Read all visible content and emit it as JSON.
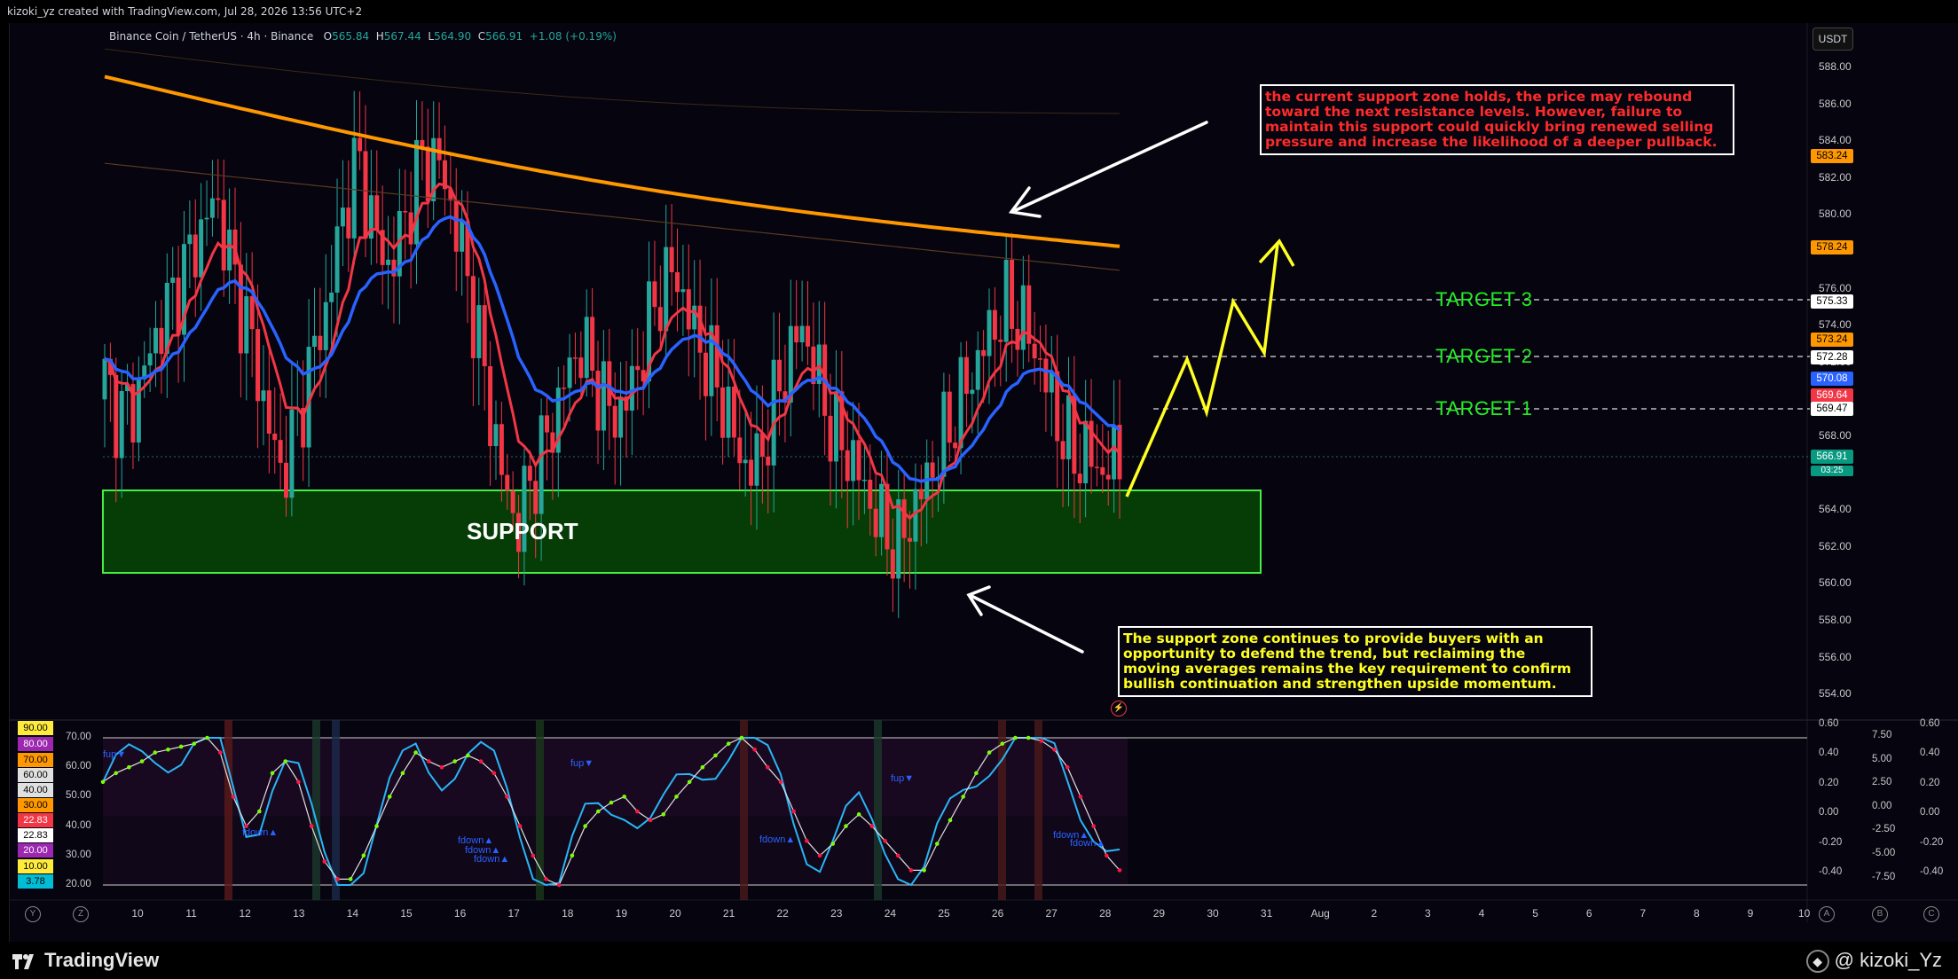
{
  "topbar": {
    "text": "kizoki_yz created with TradingView.com, Jul 28, 2026 13:56 UTC+2"
  },
  "header": {
    "symbol": "Binance Coin / TetherUS · 4h · Binance",
    "o_label": "O",
    "o": "565.84",
    "h_label": "H",
    "h": "567.44",
    "l_label": "L",
    "l": "564.90",
    "c_label": "C",
    "c": "566.91",
    "change": "+1.08 (+0.19%)"
  },
  "currency_button": "USDT",
  "notes": {
    "top": "the current support zone holds, the price may rebound toward the next resistance levels. However, failure to maintain this support could quickly bring renewed selling pressure and increase the likelihood of a deeper pullback.",
    "bottom": "The support zone continues to provide buyers with an opportunity to defend the trend, but reclaiming the moving averages remains the key requirement to confirm bullish continuation and strengthen upside momentum."
  },
  "targets": {
    "t1": "TARGET 1",
    "t2": "TARGET 2",
    "t3": "TARGET 3"
  },
  "support_label": "SUPPORT",
  "price_axis": [
    "588.00",
    "586.00",
    "584.00",
    "582.00",
    "580.00",
    "578.00",
    "576.00",
    "574.00",
    "572.00",
    "570.00",
    "568.00",
    "566.00",
    "564.00",
    "562.00",
    "560.00",
    "558.00",
    "556.00",
    "554.00"
  ],
  "price_tags": [
    {
      "value": "583.24",
      "bg": "#ff9800",
      "fg": "#000000"
    },
    {
      "value": "578.24",
      "bg": "#ff9800",
      "fg": "#000000"
    },
    {
      "value": "575.33",
      "bg": "#ffffff",
      "fg": "#000000"
    },
    {
      "value": "573.24",
      "bg": "#ff9800",
      "fg": "#000000"
    },
    {
      "value": "572.28",
      "bg": "#ffffff",
      "fg": "#000000"
    },
    {
      "value": "570.08",
      "bg": "#2962ff",
      "fg": "#ffffff"
    },
    {
      "value": "569.64",
      "bg": "#f23645",
      "fg": "#ffffff"
    },
    {
      "value": "569.47",
      "bg": "#ffffff",
      "fg": "#000000"
    },
    {
      "value": "566.91",
      "bg": "#089981",
      "fg": "#ffffff"
    }
  ],
  "countdown": "03:25",
  "time_axis": [
    "10",
    "11",
    "12",
    "13",
    "14",
    "15",
    "16",
    "17",
    "18",
    "19",
    "20",
    "21",
    "22",
    "23",
    "24",
    "25",
    "26",
    "27",
    "28",
    "29",
    "30",
    "31",
    "Aug",
    "2",
    "3",
    "4",
    "5",
    "6",
    "7",
    "8",
    "9",
    "10"
  ],
  "rsi_levels": [
    {
      "value": "90.00",
      "bg": "#ffeb3b",
      "fg": "#000000"
    },
    {
      "value": "80.00",
      "bg": "#9c27b0",
      "fg": "#ffffff"
    },
    {
      "value": "70.00",
      "bg": "#ff9800",
      "fg": "#000000"
    },
    {
      "value": "60.00",
      "bg": "#e0e0e0",
      "fg": "#000000"
    },
    {
      "value": "40.00",
      "bg": "#e0e0e0",
      "fg": "#000000"
    },
    {
      "value": "30.00",
      "bg": "#ff9800",
      "fg": "#000000"
    },
    {
      "value": "22.83",
      "bg": "#f23645",
      "fg": "#ffffff"
    },
    {
      "value": "22.83",
      "bg": "#ffffff",
      "fg": "#000000"
    },
    {
      "value": "20.00",
      "bg": "#9c27b0",
      "fg": "#ffffff"
    },
    {
      "value": "10.00",
      "bg": "#ffeb3b",
      "fg": "#000000"
    },
    {
      "value": "3.78",
      "bg": "#00bcd4",
      "fg": "#000000"
    }
  ],
  "osc_left_axis": [
    "70.00",
    "60.00",
    "50.00",
    "40.00",
    "30.00",
    "20.00"
  ],
  "osc_right_axis_a": [
    "0.60",
    "0.40",
    "0.20",
    "0.00",
    "-0.20",
    "-0.40"
  ],
  "osc_right_axis_b": [
    "7.50",
    "5.00",
    "2.50",
    "0.00",
    "-2.50",
    "-5.00",
    "-7.50"
  ],
  "osc_right_axis_c": [
    "0.60",
    "0.40",
    "0.20",
    "0.00",
    "-0.20",
    "-0.40"
  ],
  "osc_markers": [
    "fup▼",
    "fdown▲",
    "fdown▲",
    "fdown▲",
    "fdown▲",
    "fup▼",
    "fdown▲",
    "fup▼",
    "fdown▲",
    "fdown▲"
  ],
  "bottom": {
    "logo": "TradingView",
    "author": "kizoki_Yz",
    "btn_y": "Y",
    "btn_z": "Z",
    "btn_a": "A",
    "btn_b": "B",
    "btn_c": "C"
  },
  "chart_data": {
    "type": "candlestick",
    "title": "Binance Coin / TetherUS · 4h · Binance",
    "ylim": [
      553,
      589
    ],
    "x_range": [
      "10",
      "Aug 10"
    ],
    "support_zone": [
      560.5,
      565.0
    ],
    "targets": [
      569.47,
      572.28,
      575.33
    ],
    "series": [
      {
        "name": "EMA orange",
        "color": "#ff9800"
      },
      {
        "name": "EMA red",
        "color": "#f23645"
      },
      {
        "name": "EMA blue",
        "color": "#2962ff"
      }
    ],
    "last_price": 566.91
  }
}
